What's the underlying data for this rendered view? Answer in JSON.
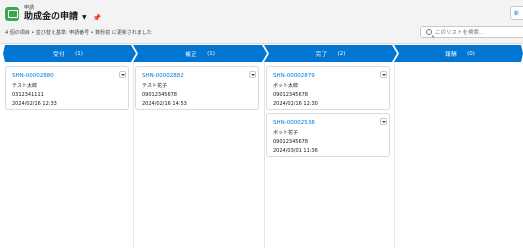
{
  "header": {
    "object_label": "申請",
    "list_title": "助成金の申請",
    "subtitle": "4 個の項目 • 並び替え基準: 申請番号 • 数秒前 に更新されました",
    "header_button_label": "新",
    "search_placeholder": "このリストを検索..."
  },
  "colors": {
    "stage_blue": "#0176d3",
    "link_blue": "#0176d3",
    "icon_green": "#3ba755"
  },
  "stages": [
    {
      "label": "受付",
      "count": "(1)"
    },
    {
      "label": "補正",
      "count": "(1)"
    },
    {
      "label": "完了",
      "count": "(2)"
    },
    {
      "label": "報酬",
      "count": "(0)"
    }
  ],
  "columns": [
    {
      "cards": [
        {
          "number": "SHN-00002880",
          "name": "テスト太郎",
          "phone": "0312341111",
          "date": "2024/02/16 12:33"
        }
      ]
    },
    {
      "cards": [
        {
          "number": "SHN-00002882",
          "name": "テスト花子",
          "phone": "09012345678",
          "date": "2024/02/16 14:53"
        }
      ]
    },
    {
      "cards": [
        {
          "number": "SHN-00002879",
          "name": "ボット太郎",
          "phone": "09012345678",
          "date": "2024/02/16 12:30"
        },
        {
          "number": "SHN-00002538",
          "name": "ボット花子",
          "phone": "09012345678",
          "date": "2024/03/01 11:36"
        }
      ]
    },
    {
      "cards": []
    }
  ]
}
